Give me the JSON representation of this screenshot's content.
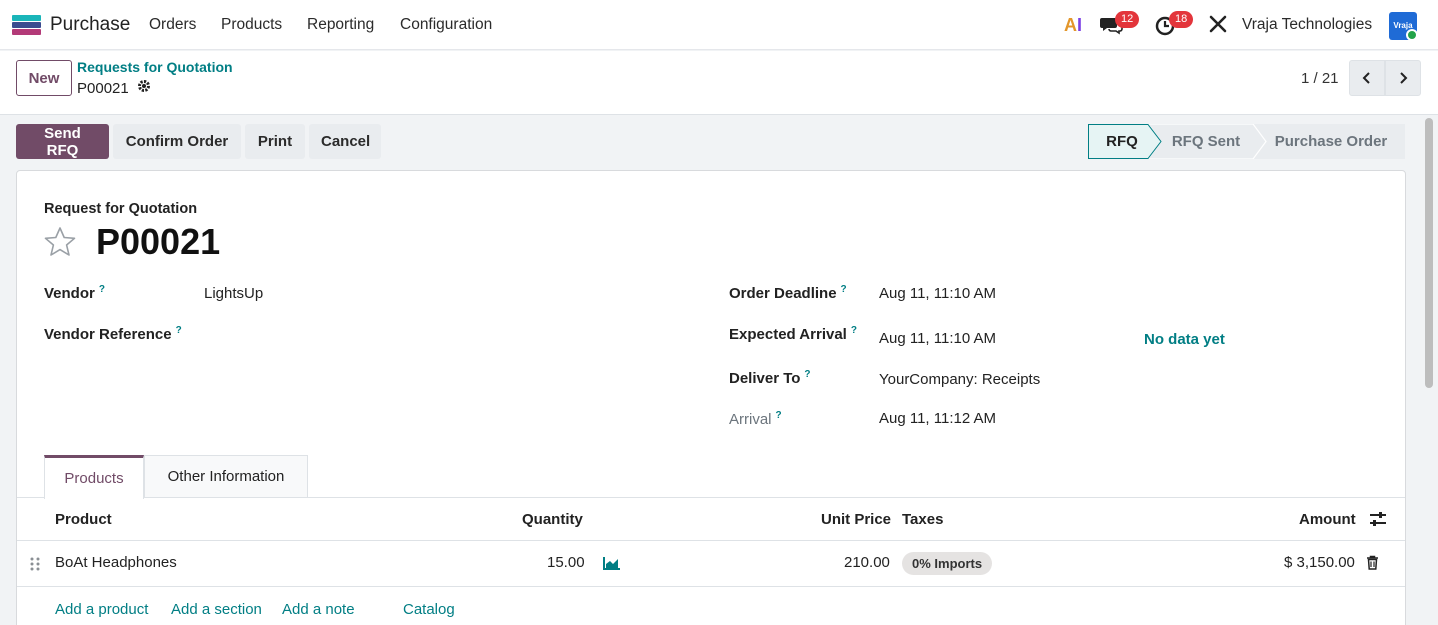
{
  "navbar": {
    "app_name": "Purchase",
    "menus": [
      "Orders",
      "Products",
      "Reporting",
      "Configuration"
    ],
    "ai_label_a": "A",
    "ai_label_i": "I",
    "messages_count": "12",
    "activities_count": "18",
    "company": "Vraja Technologies",
    "avatar_text": "Vraja"
  },
  "control": {
    "new_label": "New",
    "breadcrumb": "Requests for Quotation",
    "record": "P00021",
    "pager": "1 / 21"
  },
  "statusbar": {
    "buttons": [
      "Send RFQ",
      "Confirm Order",
      "Print",
      "Cancel"
    ],
    "stages": [
      "RFQ",
      "RFQ Sent",
      "Purchase Order"
    ],
    "active_stage": "RFQ"
  },
  "form": {
    "label": "Request for Quotation",
    "title": "P00021",
    "vendor_label": "Vendor",
    "vendor_value": "LightsUp",
    "vendor_ref_label": "Vendor Reference",
    "order_deadline_label": "Order Deadline",
    "order_deadline_value": "Aug 11, 11:10 AM",
    "expected_arrival_label": "Expected Arrival",
    "expected_arrival_value": "Aug 11, 11:10 AM",
    "no_data": "No data yet",
    "deliver_to_label": "Deliver To",
    "deliver_to_value": "YourCompany: Receipts",
    "arrival_label": "Arrival",
    "arrival_value": "Aug 11, 11:12 AM",
    "help_mark": "?"
  },
  "tabs": [
    "Products",
    "Other Information"
  ],
  "table": {
    "headers": [
      "Product",
      "Quantity",
      "Unit Price",
      "Taxes",
      "Amount"
    ],
    "rows": [
      {
        "product": "BoAt Headphones",
        "quantity": "15.00",
        "unit_price": "210.00",
        "tax": "0% Imports",
        "amount": "$ 3,150.00"
      }
    ],
    "add_links": [
      "Add a product",
      "Add a section",
      "Add a note",
      "Catalog"
    ]
  },
  "colors": {
    "primary": "#714b67",
    "link": "#017e84",
    "badge": "#e3353b"
  }
}
